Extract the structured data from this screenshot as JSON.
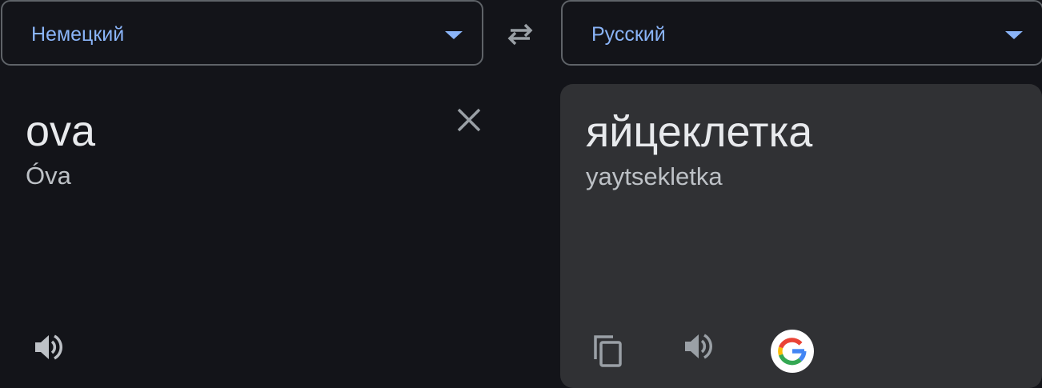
{
  "source_language": {
    "label": "Немецкий"
  },
  "target_language": {
    "label": "Русский"
  },
  "source": {
    "text": "ova",
    "transliteration": "Óva"
  },
  "target": {
    "text": "яйцеклетка",
    "transliteration": "yaytsekletka"
  },
  "icons": {
    "swap": "swap-arrows-icon",
    "clear": "close-icon",
    "source_listen": "speaker-icon",
    "copy": "copy-icon",
    "target_listen": "speaker-icon",
    "google": "google-logo-icon"
  },
  "colors": {
    "background": "#131419",
    "result_panel": "#303134",
    "accent": "#8ab4f8",
    "text_primary": "#e8eaed",
    "text_secondary": "#bdc1c6",
    "icon": "#9aa0a6"
  }
}
